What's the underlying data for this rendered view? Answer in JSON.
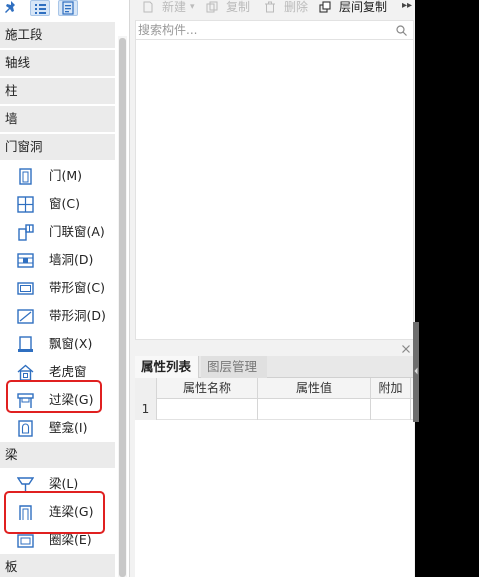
{
  "colors": {
    "icon_blue": "#2f6fc0",
    "highlight_red": "#e02020",
    "category_bg": "#ebebeb",
    "toolbar_active_bg": "#d7e6f7"
  },
  "sidebar": {
    "toolbar_icons": [
      "pin-icon",
      "list-view-icon",
      "detail-view-icon"
    ],
    "categories": {
      "stage": "施工段",
      "axis": "轴线",
      "column": "柱",
      "wall": "墙",
      "openings": "门窗洞",
      "beam": "梁",
      "slab": "板"
    },
    "openings_items": [
      {
        "label": "门(M)",
        "icon": "door-icon"
      },
      {
        "label": "窗(C)",
        "icon": "window-icon"
      },
      {
        "label": "门联窗(A)",
        "icon": "door-window-icon"
      },
      {
        "label": "墙洞(D)",
        "icon": "wall-hole-icon"
      },
      {
        "label": "带形窗(C)",
        "icon": "strip-window-icon"
      },
      {
        "label": "带形洞(D)",
        "icon": "strip-hole-icon"
      },
      {
        "label": "飘窗(X)",
        "icon": "bay-window-icon"
      },
      {
        "label": "老虎窗",
        "icon": "dormer-icon"
      },
      {
        "label": "过梁(G)",
        "icon": "lintel-icon",
        "highlighted": true
      },
      {
        "label": "壁龛(I)",
        "icon": "niche-icon"
      }
    ],
    "beam_items": [
      {
        "label": "梁(L)",
        "icon": "beam-icon"
      },
      {
        "label": "连梁(G)",
        "icon": "coupling-beam-icon",
        "highlighted": true
      },
      {
        "label": "圈梁(E)",
        "icon": "ring-beam-icon"
      }
    ]
  },
  "toolbar": {
    "new_label": "新建",
    "copy_label": "复制",
    "delete_label": "删除",
    "floor_copy_label": "层间复制"
  },
  "search": {
    "placeholder": "搜索构件..."
  },
  "properties": {
    "tabs": [
      "属性列表",
      "图层管理"
    ],
    "columns": [
      "属性名称",
      "属性值",
      "附加"
    ],
    "rows": [
      {
        "index": "1",
        "name": "",
        "value": "",
        "extra": ""
      }
    ]
  }
}
